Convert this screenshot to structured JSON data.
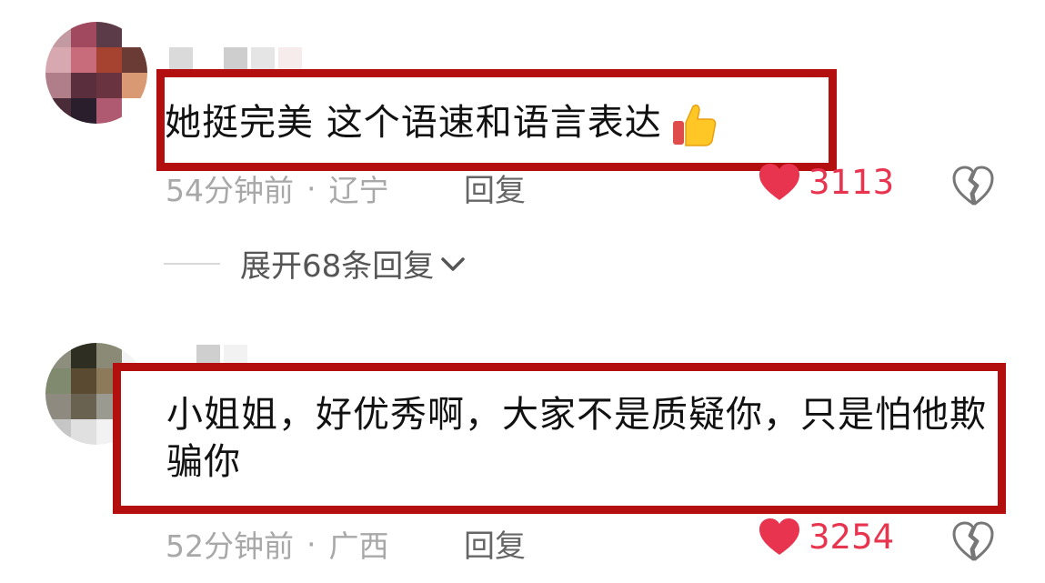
{
  "comments": [
    {
      "text": "她挺完美 这个语速和语言表达",
      "emoji": "thumbs-up-icon",
      "time": "54分钟前",
      "location": "辽宁",
      "reply_label": "回复",
      "likes": "3113",
      "expand_label": "展开68条回复"
    },
    {
      "text": "小姐姐，好优秀啊，大家不是质疑你，只是怕他欺骗你",
      "time": "52分钟前",
      "location": "广西",
      "reply_label": "回复",
      "likes": "3254"
    }
  ],
  "colors": {
    "highlight_border": "#b30f0f",
    "like_red": "#e8344e",
    "meta_gray": "#a8a8a8"
  }
}
